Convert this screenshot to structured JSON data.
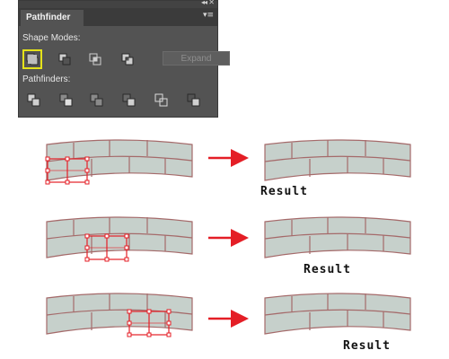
{
  "panel": {
    "collapse_glyph": "◂◂",
    "close_glyph": "✕",
    "tab_title": "Pathfinder",
    "menu_glyph": "▾≡",
    "shape_modes_label": "Shape Modes:",
    "shape_mode_icons": [
      "unite-icon",
      "minus-front-icon",
      "intersect-icon",
      "exclude-icon"
    ],
    "expand_label": "Expand",
    "pathfinders_label": "Pathfinders:",
    "pathfinder_icons": [
      "divide-icon",
      "trim-icon",
      "merge-icon",
      "crop-icon",
      "outline-icon",
      "minus-back-icon"
    ],
    "selected_color": "#e5e21a"
  },
  "diagram": {
    "brick_fill": "#c6d0cb",
    "brick_stroke": "#a56a6a",
    "selection_color": "#e41e26",
    "arrow_color": "#e41e26",
    "result_label": "Result",
    "rows": [
      {
        "result_label": "Result"
      },
      {
        "result_label": "Result"
      },
      {
        "result_label": "Result"
      }
    ]
  }
}
